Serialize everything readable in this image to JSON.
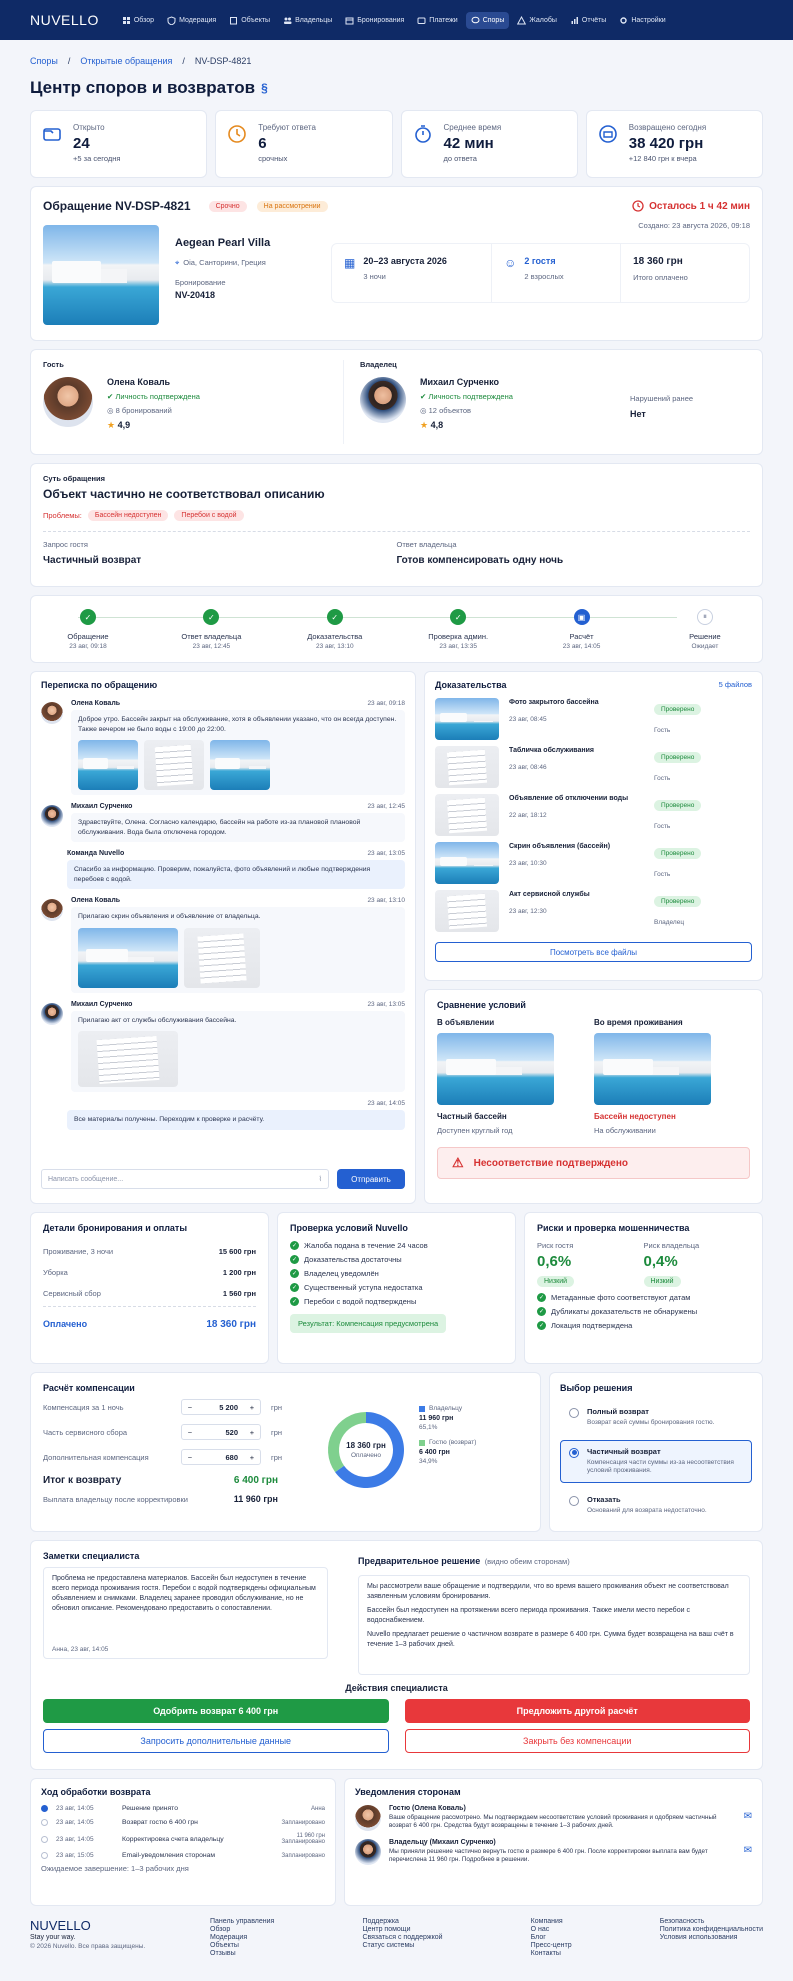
{
  "app": {
    "logo": "NUVELLO"
  },
  "nav": [
    {
      "label": "Обзор",
      "icon": "grid-icon"
    },
    {
      "label": "Модерация",
      "icon": "shield-icon"
    },
    {
      "label": "Объекты",
      "icon": "building-icon"
    },
    {
      "label": "Владельцы",
      "icon": "users-icon"
    },
    {
      "label": "Бронирования",
      "icon": "calendar-icon"
    },
    {
      "label": "Платежи",
      "icon": "wallet-icon"
    },
    {
      "label": "Споры",
      "icon": "chat-icon",
      "active": true
    },
    {
      "label": "Жалобы",
      "icon": "alert-icon"
    },
    {
      "label": "Отчёты",
      "icon": "chart-icon"
    },
    {
      "label": "Настройки",
      "icon": "gear-icon"
    }
  ],
  "breadcrumb": [
    "Споры",
    "Открытые обращения",
    "NV-DSP-4821"
  ],
  "page_title": "Центр споров и возвратов",
  "stats": [
    {
      "label": "Открыто",
      "value": "24",
      "sub": "+5 за сегодня",
      "color": "#2460d1"
    },
    {
      "label": "Требуют ответа",
      "value": "6",
      "sub": "срочных",
      "color": "#e58a1f"
    },
    {
      "label": "Среднее время",
      "value": "42 мин",
      "sub": "до ответа",
      "color": "#2460d1"
    },
    {
      "label": "Возвращено сегодня",
      "value": "38 420 грн",
      "sub": "+12 840 грн к вчера",
      "color": "#2460d1"
    }
  ],
  "case": {
    "title": "Обращение NV-DSP-4821",
    "badge_urgent": "Срочно",
    "badge_status": "На рассмотрении",
    "timer": "Осталось 1 ч 42 мин",
    "created": "Создано: 23 августа 2026, 09:18",
    "property": "Aegean Pearl Villa",
    "location": "Oia, Санторини, Греция",
    "booking_label": "Бронирование",
    "booking_id": "NV-20418",
    "dates": "20–23 августа 2026",
    "nights": "3 ночи",
    "guests": "2 гостя",
    "guests_sub": "2 взрослых",
    "total": "18 360 грн",
    "total_sub": "Итого оплачено"
  },
  "guest": {
    "section": "Гость",
    "name": "Олена Коваль",
    "verified": "Личность подтверждена",
    "bookings": "8 бронирований",
    "rating": "4,9"
  },
  "owner": {
    "section": "Владелец",
    "name": "Михаил Сурченко",
    "verified": "Личность подтверждена",
    "objects": "12 объектов",
    "rating": "4,8",
    "violations_label": "Нарушений ранее",
    "violations": "Нет"
  },
  "issue": {
    "label": "Суть обращения",
    "title": "Объект частично не соответствовал описанию",
    "problems_label": "Проблемы:",
    "tags": [
      "Бассейн недоступен",
      "Перебои с водой"
    ],
    "guest_req_label": "Запрос гостя",
    "guest_req": "Частичный возврат",
    "owner_resp_label": "Ответ владельца",
    "owner_resp": "Готов компенсировать одну ночь"
  },
  "steps": [
    {
      "label": "Обращение",
      "date": "23 авг, 09:18",
      "state": "done"
    },
    {
      "label": "Ответ владельца",
      "date": "23 авг, 12:45",
      "state": "done"
    },
    {
      "label": "Доказательства",
      "date": "23 авг, 13:10",
      "state": "done"
    },
    {
      "label": "Проверка админ.",
      "date": "23 авг, 13:35",
      "state": "done"
    },
    {
      "label": "Расчёт",
      "date": "23 авг, 14:05",
      "state": "current"
    },
    {
      "label": "Решение",
      "date": "Ожидает",
      "state": "pending"
    }
  ],
  "chat": {
    "title": "Переписка по обращению",
    "messages": [
      {
        "author": "Олена Коваль",
        "time": "23 авг, 09:18",
        "text": "Доброе утро. Бассейн закрыт на обслуживание, хотя в объявлении указано, что он всегда доступен. Также вечером не было воды с 19:00 до 22:00."
      },
      {
        "author": "Михаил Сурченко",
        "time": "23 авг, 12:45",
        "text": "Здравствуйте, Олена. Согласно календарю, бассейн на работе из-за плановой плановой обслуживания. Вода была отключена городом."
      },
      {
        "author": "Команда Nuvello",
        "time": "23 авг, 13:05",
        "text": "Спасибо за информацию. Проверим, пожалуйста, фото объявлений и любые подтверждения перебоев с водой."
      },
      {
        "author": "Олена Коваль",
        "time": "23 авг, 13:10",
        "text": "Прилагаю скрин объявления и объявление от владельца."
      },
      {
        "author": "Михаил Сурченко",
        "time": "23 авг, 13:05",
        "text": "Прилагаю акт от службы обслуживания бассейна."
      },
      {
        "author": "",
        "time": "23 авг, 14:05",
        "text": "Все материалы получены. Переходим к проверке и расчёту."
      }
    ],
    "placeholder": "Написать сообщение...",
    "send": "Отправить"
  },
  "evidence": {
    "title": "Доказательства",
    "count": "5 файлов",
    "items": [
      {
        "name": "Фото закрытого бассейна",
        "date": "23 авг, 08:45",
        "by": "Гость",
        "status": "Проверено",
        "kind": "photo"
      },
      {
        "name": "Табличка обслуживания",
        "date": "23 авг, 08:46",
        "by": "Гость",
        "status": "Проверено",
        "kind": "doc"
      },
      {
        "name": "Объявление об отключении воды",
        "date": "22 авг, 18:12",
        "by": "Гость",
        "status": "Проверено",
        "kind": "doc"
      },
      {
        "name": "Скрин объявления (бассейн)",
        "date": "23 авг, 10:30",
        "by": "Гость",
        "status": "Проверено",
        "kind": "photo"
      },
      {
        "name": "Акт сервисной службы",
        "date": "23 авг, 12:30",
        "by": "Владелец",
        "status": "Проверено",
        "kind": "doc"
      }
    ],
    "view_all": "Посмотреть все файлы"
  },
  "compare": {
    "title": "Сравнение условий",
    "left_h": "В объявлении",
    "right_h": "Во время проживания",
    "left_cap": "Частный бассейн",
    "left_sub": "Доступен круглый год",
    "right_cap": "Бассейн недоступен",
    "right_sub": "На обслуживании",
    "alert": "Несоответствие подтверждено"
  },
  "payment": {
    "title": "Детали бронирования и оплаты",
    "rows": [
      {
        "label": "Проживание, 3 ночи",
        "value": "15 600 грн"
      },
      {
        "label": "Уборка",
        "value": "1 200 грн"
      },
      {
        "label": "Сервисный сбор",
        "value": "1 560 грн"
      }
    ],
    "total_label": "Оплачено",
    "total": "18 360 грн"
  },
  "checks": {
    "title": "Проверка условий Nuvello",
    "items": [
      "Жалоба подана в течение 24 часов",
      "Доказательства достаточны",
      "Владелец уведомлён",
      "Существенный уступа недостатка",
      "Перебои с водой подтверждены"
    ],
    "result": "Результат: Компенсация предусмотрена"
  },
  "risk": {
    "title": "Риски и проверка мошенничества",
    "guest_label": "Риск гостя",
    "guest_val": "0,6%",
    "owner_label": "Риск владельца",
    "owner_val": "0,4%",
    "level": "Низкий",
    "items": [
      "Метаданные фото соответствуют датам",
      "Дубликаты доказательств не обнаружены",
      "Локация подтверждена"
    ]
  },
  "calc": {
    "title": "Расчёт компенсации",
    "rows": [
      {
        "label": "Компенсация за 1 ночь",
        "value": "5 200",
        "unit": "грн"
      },
      {
        "label": "Часть сервисного сбора",
        "value": "520",
        "unit": "грн"
      },
      {
        "label": "Дополнительная компенсация",
        "value": "680",
        "unit": "грн"
      }
    ],
    "total_label": "Итог к возврату",
    "total": "6 400 грн",
    "payout_label": "Выплата владельцу после корректировки",
    "payout": "11 960 грн",
    "donut_value": "18 360 грн",
    "donut_sub": "Оплачено",
    "legend": [
      {
        "name": "Владельцу",
        "value": "11 960 грн",
        "pct": "65,1%",
        "color": "#3c7be6"
      },
      {
        "name": "Гостю (возврат)",
        "value": "6 400 грн",
        "pct": "34,9%",
        "color": "#7fd08e"
      }
    ]
  },
  "chart_data": {
    "type": "pie",
    "categories": [
      "Владельцу",
      "Гостю (возврат)"
    ],
    "values": [
      65.1,
      34.9
    ],
    "title": "18 360 грн"
  },
  "decision": {
    "title": "Выбор решения",
    "options": [
      {
        "label": "Полный возврат",
        "desc": "Возврат всей суммы бронирования гостю.",
        "selected": false
      },
      {
        "label": "Частичный возврат",
        "desc": "Компенсация части суммы из-за несоответствия условий проживания.",
        "selected": true
      },
      {
        "label": "Отказать",
        "desc": "Оснований для возврата недостаточно.",
        "selected": false
      }
    ]
  },
  "notes": {
    "title": "Заметки специалиста",
    "text": "Проблема не предоставлена материалов. Бассейн был недоступен в течение всего периода проживания гостя. Перебои с водой подтверждены официальным объявлением и снимками. Владелец заранее проводил обслуживание, но не обновил описание. Рекомендовано предоставить о сопоставлении.",
    "author": "Анна, 23 авг, 14:05"
  },
  "prelim": {
    "title": "Предварительное решение",
    "hint": "(видно обеим сторонам)",
    "p1": "Мы рассмотрели ваше обращение и подтвердили, что во время вашего проживания объект не соответствовал заявленным условиям бронирования.",
    "p2": "Бассейн был недоступен на протяжении всего периода проживания. Также имели место перебои с водоснабжением.",
    "p3": "Nuvello предлагает решение о частичном возврате в размере 6 400 грн. Сумма будет возвращена на ваш счёт в течение 1–3 рабочих дней."
  },
  "actions": {
    "title": "Действия специалиста",
    "approve": "Одобрить возврат 6 400 грн",
    "other": "Предложить другой расчёт",
    "more": "Запросить дополнительные данные",
    "close": "Закрыть без компенсации"
  },
  "progress": {
    "title": "Ход обработки возврата",
    "items": [
      {
        "time": "23 авг, 14:05",
        "text": "Решение принято",
        "who": "Анна",
        "active": true
      },
      {
        "time": "23 авг, 14:05",
        "text": "Возврат гостю 6 400 грн",
        "who": "Запланировано"
      },
      {
        "time": "23 авг, 14:05",
        "text": "Корректировка счета владельцу",
        "who": "11 960 грн Запланировано"
      },
      {
        "time": "23 авг, 15:05",
        "text": "Email-уведомления сторонам",
        "who": "Запланировано"
      }
    ],
    "expected": "Ожидаемое завершение: 1–3 рабочих дня"
  },
  "notify": {
    "title": "Уведомления сторонам",
    "items": [
      {
        "to": "Гостю (Олена Коваль)",
        "text": "Ваше обращение рассмотрено. Мы подтверждаем несоответствие условий проживания и одобряем частичный возврат 6 400 грн. Средства будут возвращены в течение 1–3 рабочих дней."
      },
      {
        "to": "Владельцу (Михаил Сурченко)",
        "text": "Мы приняли решение частично вернуть гостю в размере 6 400 грн. После корректировки выплата вам будет перечислена 11 960 грн. Подробнее в решении."
      }
    ]
  },
  "footer": {
    "logo": "NUVELLO",
    "tagline": "Stay your way.",
    "copy": "© 2026 Nuvello. Все права защищены.",
    "cols": [
      [
        "Панель управления",
        "Обзор",
        "Модерация",
        "Объекты",
        "Отзывы"
      ],
      [
        "Поддержка",
        "Центр помощи",
        "Связаться с поддержкой",
        "Статус системы"
      ],
      [
        "Компания",
        "О нас",
        "Блог",
        "Пресс-центр",
        "Контакты"
      ],
      [
        "Безопасность",
        "Политика конфиденциальности",
        "Условия использования"
      ]
    ]
  }
}
